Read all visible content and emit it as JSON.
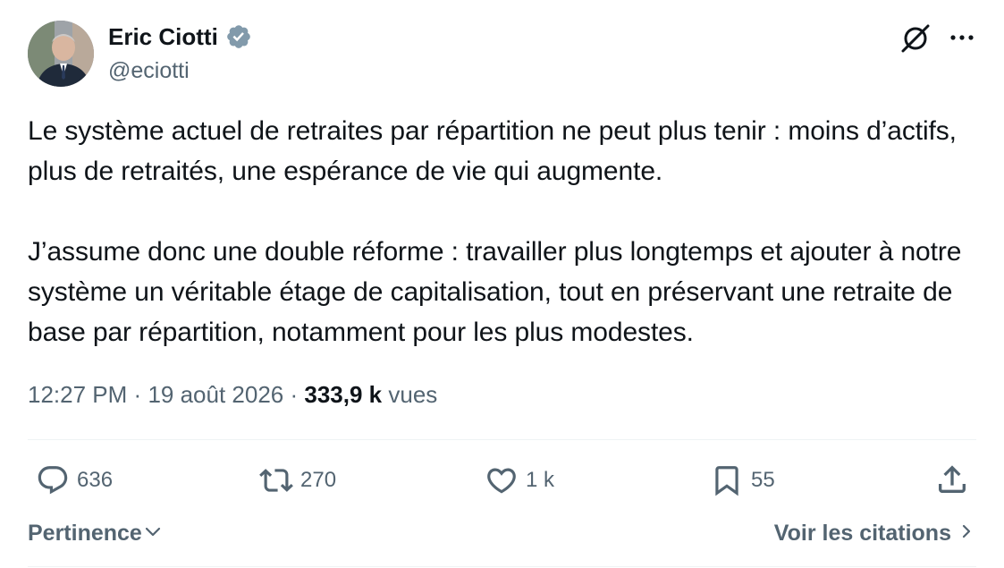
{
  "author": {
    "name": "Eric Ciotti",
    "handle": "@eciotti",
    "verified": true
  },
  "tweet": {
    "paragraphs": [
      "Le système actuel de retraites par répartition ne peut plus tenir : moins d’actifs, plus de retraités, une espérance de vie qui augmente.",
      "J’assume donc une double réforme : travailler plus longtemps et ajouter à notre système un véritable étage de capitalisation, tout en préservant une retraite de base par répartition, notamment pour les plus modestes."
    ]
  },
  "meta": {
    "time": "12:27 PM",
    "separator": "·",
    "date": "19 août 2026",
    "views_count": "333,9 k",
    "views_label": "vues"
  },
  "actions": {
    "replies": "636",
    "reposts": "270",
    "likes": "1 k",
    "bookmarks": "55"
  },
  "footer": {
    "sort_label": "Pertinence",
    "quotes_label": "Voir les citations"
  },
  "colors": {
    "text_primary": "#0f1419",
    "text_secondary": "#536471",
    "verified_blue": "#829aab",
    "divider": "#eff3f4"
  },
  "icons": {
    "grok": "grok-icon",
    "more": "more-icon",
    "reply": "reply-icon",
    "repost": "repost-icon",
    "like": "like-icon",
    "bookmark": "bookmark-icon",
    "share": "share-icon",
    "chevron_down": "chevron-down-icon",
    "chevron_right": "chevron-right-icon"
  }
}
